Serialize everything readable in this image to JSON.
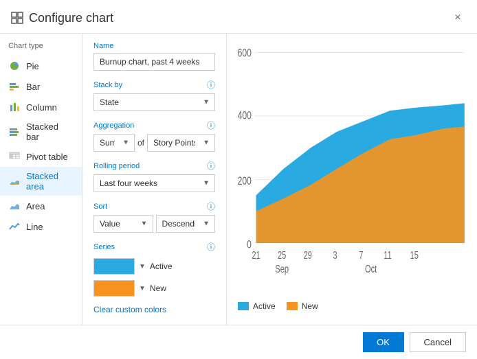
{
  "dialog": {
    "title": "Configure chart",
    "close_label": "×"
  },
  "chart_types_label": "Chart type",
  "chart_types": [
    {
      "id": "pie",
      "label": "Pie",
      "icon": "pie"
    },
    {
      "id": "bar",
      "label": "Bar",
      "icon": "bar"
    },
    {
      "id": "column",
      "label": "Column",
      "icon": "column"
    },
    {
      "id": "stacked-bar",
      "label": "Stacked bar",
      "icon": "stacked-bar"
    },
    {
      "id": "pivot-table",
      "label": "Pivot table",
      "icon": "pivot"
    },
    {
      "id": "stacked-area",
      "label": "Stacked area",
      "icon": "stacked-area",
      "active": true
    },
    {
      "id": "area",
      "label": "Area",
      "icon": "area"
    },
    {
      "id": "line",
      "label": "Line",
      "icon": "line"
    }
  ],
  "form": {
    "name_label": "Name",
    "name_value": "Burnup chart, past 4 weeks",
    "stack_by_label": "Stack by",
    "stack_by_value": "State",
    "aggregation_label": "Aggregation",
    "aggregation_func": "Sum",
    "aggregation_of": "of",
    "aggregation_field": "Story Points",
    "rolling_period_label": "Rolling period",
    "rolling_period_value": "Last four weeks",
    "sort_label": "Sort",
    "sort_by": "Value",
    "sort_order": "Descending",
    "series_label": "Series",
    "series": [
      {
        "name": "Active",
        "color": "#29ABE2"
      },
      {
        "name": "New",
        "color": "#F7941D"
      }
    ],
    "clear_colors_label": "Clear custom colors"
  },
  "chart": {
    "y_labels": [
      "600",
      "400",
      "200",
      "0"
    ],
    "x_labels": [
      "21",
      "25",
      "29",
      "3",
      "7",
      "11",
      "15"
    ],
    "x_groups": [
      "Sep",
      "Oct"
    ],
    "legend": [
      {
        "label": "Active",
        "color": "#29ABE2"
      },
      {
        "label": "New",
        "color": "#F7941D"
      }
    ]
  },
  "footer": {
    "ok_label": "OK",
    "cancel_label": "Cancel"
  }
}
